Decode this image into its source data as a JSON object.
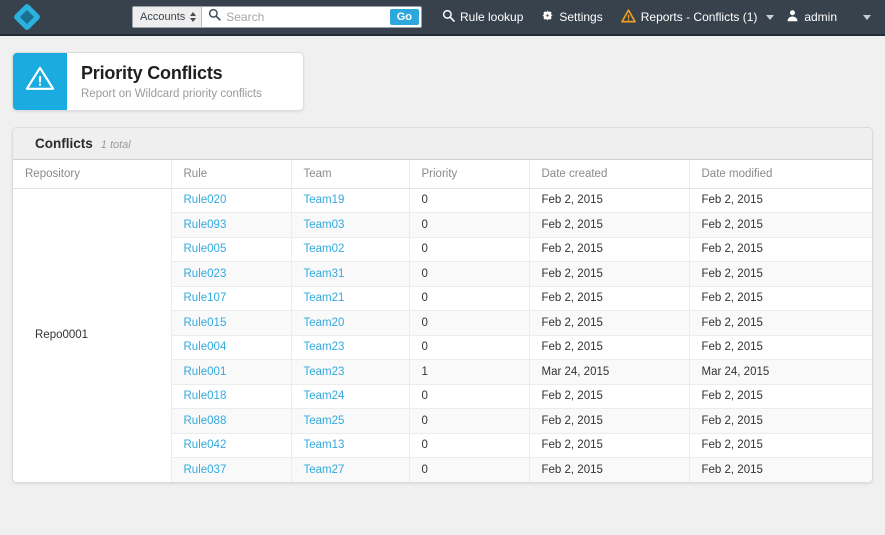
{
  "topbar": {
    "logo_name": "app-logo",
    "search": {
      "scope_label": "Accounts",
      "placeholder": "Search",
      "value": "",
      "go_label": "Go"
    },
    "nav": [
      {
        "label": "Rule lookup",
        "icon": "search-icon"
      },
      {
        "label": "Settings",
        "icon": "gear-icon"
      },
      {
        "label": "Reports - Conflicts (1)",
        "icon": "warning-triangle-icon"
      }
    ],
    "user": {
      "label": "admin",
      "icon": "user-icon"
    }
  },
  "page_header": {
    "icon": "warning-triangle-icon",
    "title": "Priority Conflicts",
    "subtitle": "Report on Wildcard priority conflicts"
  },
  "table_card": {
    "title": "Conflicts",
    "count_label": "1 total",
    "columns": [
      "Repository",
      "Rule",
      "Team",
      "Priority",
      "Date created",
      "Date modified"
    ],
    "repository": "Repo0001",
    "rows": [
      {
        "rule": "Rule020",
        "team": "Team19",
        "priority": "0",
        "date_created": "Feb 2, 2015",
        "date_modified": "Feb 2, 2015"
      },
      {
        "rule": "Rule093",
        "team": "Team03",
        "priority": "0",
        "date_created": "Feb 2, 2015",
        "date_modified": "Feb 2, 2015"
      },
      {
        "rule": "Rule005",
        "team": "Team02",
        "priority": "0",
        "date_created": "Feb 2, 2015",
        "date_modified": "Feb 2, 2015"
      },
      {
        "rule": "Rule023",
        "team": "Team31",
        "priority": "0",
        "date_created": "Feb 2, 2015",
        "date_modified": "Feb 2, 2015"
      },
      {
        "rule": "Rule107",
        "team": "Team21",
        "priority": "0",
        "date_created": "Feb 2, 2015",
        "date_modified": "Feb 2, 2015"
      },
      {
        "rule": "Rule015",
        "team": "Team20",
        "priority": "0",
        "date_created": "Feb 2, 2015",
        "date_modified": "Feb 2, 2015"
      },
      {
        "rule": "Rule004",
        "team": "Team23",
        "priority": "0",
        "date_created": "Feb 2, 2015",
        "date_modified": "Feb 2, 2015"
      },
      {
        "rule": "Rule001",
        "team": "Team23",
        "priority": "1",
        "date_created": "Mar 24, 2015",
        "date_modified": "Mar 24, 2015"
      },
      {
        "rule": "Rule018",
        "team": "Team24",
        "priority": "0",
        "date_created": "Feb 2, 2015",
        "date_modified": "Feb 2, 2015"
      },
      {
        "rule": "Rule088",
        "team": "Team25",
        "priority": "0",
        "date_created": "Feb 2, 2015",
        "date_modified": "Feb 2, 2015"
      },
      {
        "rule": "Rule042",
        "team": "Team13",
        "priority": "0",
        "date_created": "Feb 2, 2015",
        "date_modified": "Feb 2, 2015"
      },
      {
        "rule": "Rule037",
        "team": "Team27",
        "priority": "0",
        "date_created": "Feb 2, 2015",
        "date_modified": "Feb 2, 2015"
      }
    ]
  },
  "colors": {
    "topbar_bg": "#37424d",
    "accent": "#2ca8dd",
    "link": "#32aadf",
    "warning": "#f5a01e",
    "page_bg": "#f0f0f0"
  }
}
